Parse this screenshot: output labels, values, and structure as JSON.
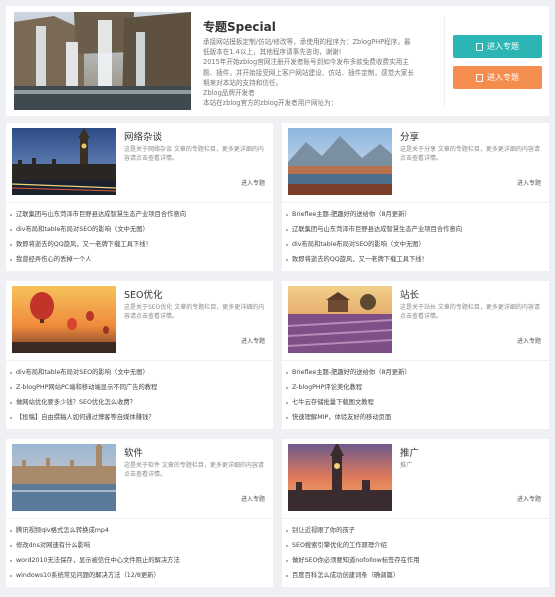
{
  "hero": {
    "title": "专题Special",
    "desc_lines": [
      "承接网站模板定制/仿站/修改等，承使用的程序为：ZblogPHP程序，最",
      "低版本在1.4以上，其他程序请事先咨询，谢谢!",
      "2015年开始zblog官网注册开发者账号到如今发布多款免费收费实用主",
      "题、插件，并开始接受网上客户网站建设、仿站、插件定制，感觉大家长",
      "期来对本站的支持和信任。",
      "Zblog品牌开发者",
      "本站在zblog官方的zblog开发者用户网址为："
    ],
    "btn_teal": "进入专题",
    "btn_orange": "进入专题",
    "colors": {
      "teal": "#2cb5b5",
      "orange": "#f58d4e"
    }
  },
  "cards": [
    {
      "title": "网络杂谈",
      "desc": "这是关于网络杂谈 文章的专题栏目，更多更详细的内容请点击查看详情。",
      "more": "进入专题",
      "image": "london-big-ben",
      "items": [
        "辽联集团与山东菏泽市巨野县达成智慧生态产业项目合作意向",
        "div布局和table布局对SEO的影响（文中无图）",
        "致即将逝去的QQ旋风，又一老牌下载工具下线！",
        "我曾经弄伤心的丢掉一个人"
      ]
    },
    {
      "title": "分享",
      "desc": "这是关于分享 文章的专题栏目，更多更详细的内容请点击查看详情。",
      "more": "进入专题",
      "image": "lake-mountains",
      "items": [
        "Brieflee主题-肥趣好的送给你（8月更新）",
        "辽联集团与山东菏泽市巨野县达成智慧生态产业项目合作意向",
        "div布局和table布局对SEO的影响（文中无图）",
        "致即将逝去的QQ旋风，又一老牌下载工具下线！"
      ]
    },
    {
      "title": "SEO优化",
      "desc": "这是关于SEO优化 文章的专题栏目，更多更详细的内容请点击查看详情。",
      "more": "进入专题",
      "image": "hot-air-balloons",
      "items": [
        "div布局和table布局对SEO的影响（文中无图）",
        "Z-blogPHP网站PC端和移动端显示不同广告的教程",
        "做网站优化要多少钱？SEO优化怎么收费？",
        "【投稿】自由撰稿人如何通过博客等自媒体赚钱？"
      ]
    },
    {
      "title": "站长",
      "desc": "这是关于站长 文章的专题栏目，更多更详细的内容请点击查看详情。",
      "more": "进入专题",
      "image": "lavender-field",
      "items": [
        "Brieflee主题-肥趣好的送给你（8月更新）",
        "Z-blogPHP评论美化教程",
        "七牛云存储批量下载图文教程",
        "快速理解MIP，体验友好的移动页面"
      ]
    },
    {
      "title": "软件",
      "desc": "这是关于软件 文章的专题栏目，更多更详细的内容请点击查看详情。",
      "more": "进入专题",
      "image": "london-thames",
      "items": [
        "腾讯视频qlv格式怎么转换成mp4",
        "修改dns对网速有什么影响",
        "word2010无法保存，显示被信任中心文件阻止的解决方法",
        "windows10系统常见问题的解决方法（12/8更新）"
      ]
    },
    {
      "title": "推广",
      "desc": "推广",
      "more": "进入专题",
      "image": "big-ben-sunset",
      "items": [
        "别让近视眼了你的孩子",
        "SEO搜索引擎优化的工作原理介绍",
        "做好SEO你必须要知道nofollow标签存在作用",
        "百度百科怎么成功创建词条（确调篇）"
      ]
    }
  ]
}
